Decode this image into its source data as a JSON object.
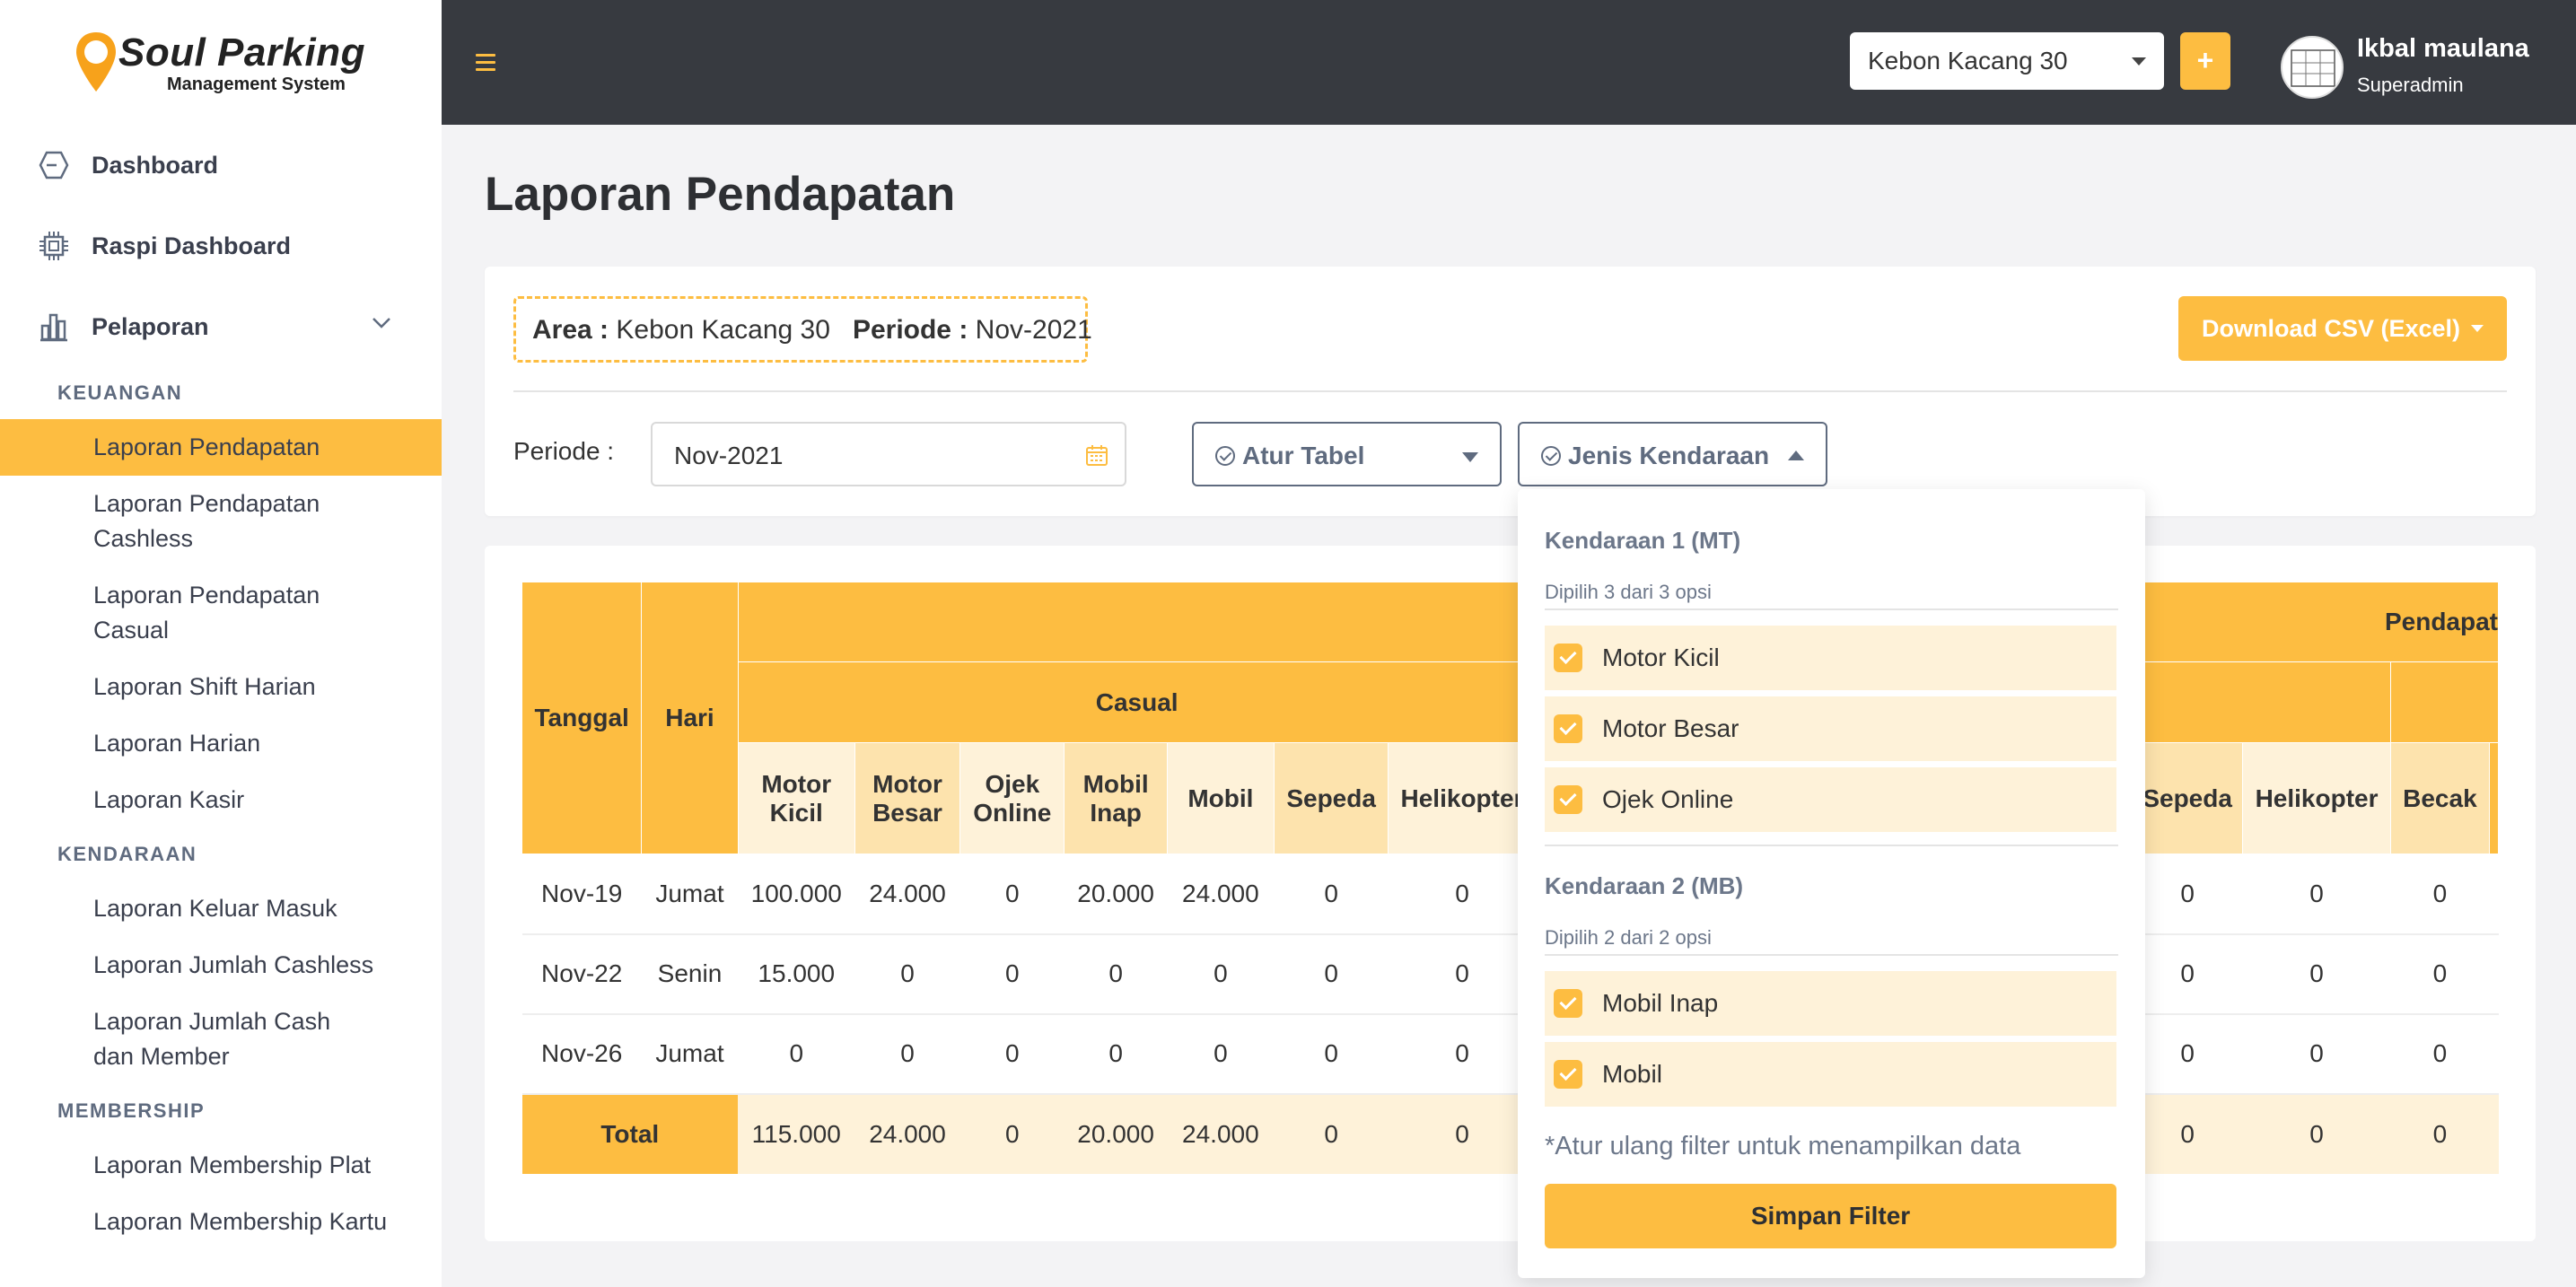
{
  "brand": {
    "name": "Soul Parking",
    "subtitle": "Management System"
  },
  "sidebar": {
    "top_items": [
      {
        "label": "Dashboard",
        "icon": "hexagon-icon"
      },
      {
        "label": "Raspi Dashboard",
        "icon": "chip-icon"
      },
      {
        "label": "Pelaporan",
        "icon": "bar-chart-icon"
      }
    ],
    "sections": [
      {
        "title": "KEUANGAN",
        "items": [
          "Laporan Pendapatan",
          "Laporan Pendapatan Cashless",
          "Laporan Pendapatan Casual",
          "Laporan Shift Harian",
          "Laporan Harian",
          "Laporan Kasir"
        ]
      },
      {
        "title": "KENDARAAN",
        "items": [
          "Laporan Keluar Masuk",
          "Laporan Jumlah Cashless",
          "Laporan Jumlah Cash dan Member"
        ]
      },
      {
        "title": "MEMBERSHIP",
        "items": [
          "Laporan Membership Plat",
          "Laporan Membership Kartu"
        ]
      }
    ],
    "active_item": "Laporan Pendapatan"
  },
  "header": {
    "area_selected": "Kebon Kacang 30",
    "add_label": "+",
    "user_name": "Ikbal maulana",
    "user_role": "Superadmin"
  },
  "page": {
    "title": "Laporan Pendapatan"
  },
  "filters": {
    "area_label": "Area :",
    "area_value": "Kebon Kacang 30",
    "periode_label_bold": "Periode :",
    "periode_value": "Nov-2021",
    "download_label": "Download CSV (Excel)",
    "periode_field_label": "Periode :",
    "periode_input_value": "Nov-2021",
    "atur_tabel_label": "Atur Tabel",
    "jenis_kendaraan_label": "Jenis Kendaraan"
  },
  "table": {
    "group_header_right": "Pendapat",
    "col_tanggal": "Tanggal",
    "col_hari": "Hari",
    "casual_label": "Casual",
    "left_cols": [
      "Motor Kicil",
      "Motor Besar",
      "Ojek Online",
      "Mobil Inap",
      "Mobil",
      "Sepeda",
      "Helikopter"
    ],
    "right_cols": [
      "Sepeda",
      "Helikopter",
      "Becak"
    ],
    "rows": [
      {
        "tanggal": "Nov-19",
        "hari": "Jumat",
        "left": [
          "100.000",
          "24.000",
          "0",
          "20.000",
          "24.000",
          "0",
          "0"
        ],
        "right": [
          "0",
          "0",
          "0"
        ]
      },
      {
        "tanggal": "Nov-22",
        "hari": "Senin",
        "left": [
          "15.000",
          "0",
          "0",
          "0",
          "0",
          "0",
          "0"
        ],
        "right": [
          "0",
          "0",
          "0"
        ]
      },
      {
        "tanggal": "Nov-26",
        "hari": "Jumat",
        "left": [
          "0",
          "0",
          "0",
          "0",
          "0",
          "0",
          "0"
        ],
        "right": [
          "0",
          "0",
          "0"
        ]
      }
    ],
    "total": {
      "label": "Total",
      "left": [
        "115.000",
        "24.000",
        "0",
        "20.000",
        "24.000",
        "0",
        "0"
      ],
      "right": [
        "0",
        "0",
        "0"
      ]
    }
  },
  "dropdown": {
    "groups": [
      {
        "title": "Kendaraan 1 (MT)",
        "subtitle": "Dipilih 3 dari 3 opsi",
        "options": [
          "Motor Kicil",
          "Motor Besar",
          "Ojek Online"
        ]
      },
      {
        "title": "Kendaraan 2 (MB)",
        "subtitle": "Dipilih 2 dari 2 opsi",
        "options": [
          "Mobil Inap",
          "Mobil"
        ]
      }
    ],
    "note": "*Atur ulang filter untuk menampilkan data",
    "save_label": "Simpan Filter"
  },
  "colors": {
    "accent": "#fdbd41",
    "topbar": "#373a40",
    "light": "#fef2d9"
  }
}
